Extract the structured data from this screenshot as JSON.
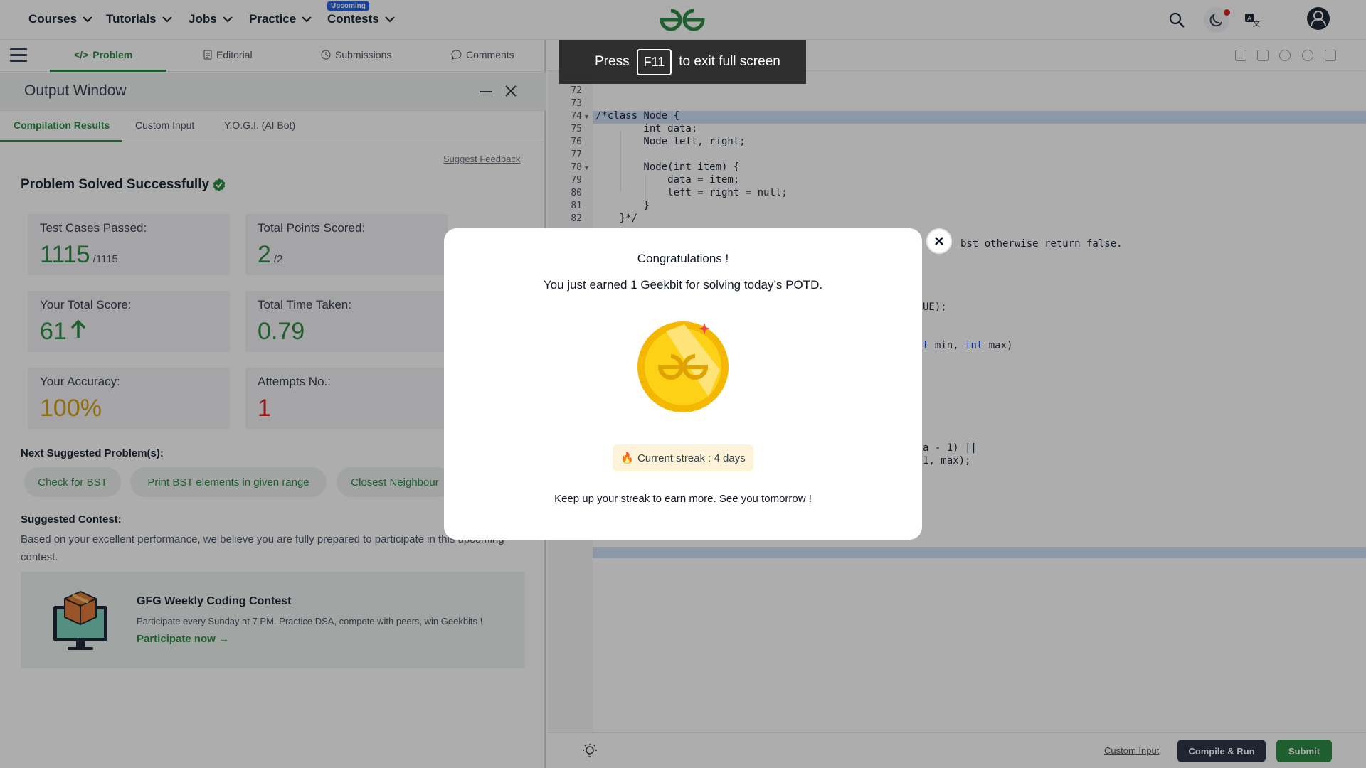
{
  "nav": {
    "items": [
      {
        "label": "Courses"
      },
      {
        "label": "Tutorials"
      },
      {
        "label": "Jobs"
      },
      {
        "label": "Practice"
      },
      {
        "label": "Contests"
      }
    ],
    "badge": "Upcoming",
    "icons": [
      "search-icon",
      "dark-mode-icon",
      "translate-icon",
      "profile-icon"
    ],
    "brand_color": "#2f8d46"
  },
  "problem_tabs": [
    {
      "label": "Problem",
      "icon": "code-icon"
    },
    {
      "label": "Editorial",
      "icon": "document-icon"
    },
    {
      "label": "Submissions",
      "icon": "clock-icon"
    },
    {
      "label": "Comments",
      "icon": "chat-icon"
    }
  ],
  "output_window": {
    "title": "Output Window",
    "tabs": [
      "Compilation Results",
      "Custom Input",
      "Y.O.G.I. (AI Bot)"
    ],
    "feedback": "Suggest Feedback",
    "status": "Problem Solved Successfully",
    "stats": {
      "tests_label": "Test Cases Passed:",
      "tests_value": "1115",
      "tests_total": "/1115",
      "points_label": "Total Points Scored:",
      "points_value": "2",
      "points_total": "/2",
      "score_label": "Your Total Score:",
      "score_value": "61",
      "time_label": "Total Time Taken:",
      "time_value": "0.79",
      "accuracy_label": "Your Accuracy:",
      "accuracy_value": "100%",
      "attempts_label": "Attempts No.:",
      "attempts_value": "1"
    },
    "next_label": "Next Suggested Problem(s):",
    "next_problems": [
      "Check for BST",
      "Print BST elements in given range",
      "Closest Neighbour"
    ],
    "contest_label": "Suggested Contest:",
    "contest_desc": "Based on your excellent performance, we believe you are fully prepared to participate in this upcoming contest.",
    "contest": {
      "title": "GFG Weekly Coding Contest",
      "text": "Participate every Sunday at 7 PM. Practice DSA, compete with peers, win Geekbits !",
      "link": "Participate now"
    }
  },
  "editor": {
    "lines": [
      {
        "n": "72",
        "code": ""
      },
      {
        "n": "73",
        "code": ""
      },
      {
        "n": "74",
        "code": "/*class Node {"
      },
      {
        "n": "75",
        "code": "        int data;"
      },
      {
        "n": "76",
        "code": "        Node left, right;"
      },
      {
        "n": "77",
        "code": ""
      },
      {
        "n": "78",
        "code": "        Node(int item) {"
      },
      {
        "n": "79",
        "code": "            data = item;"
      },
      {
        "n": "80",
        "code": "            left = right = null;"
      },
      {
        "n": "81",
        "code": "        }"
      },
      {
        "n": "82",
        "code": "    }*/"
      }
    ],
    "frag1": "bst otherwise return false.",
    "frag2": "UE);",
    "frag3_kw1": "t",
    "frag3_mid": " min, ",
    "frag3_kw2": "int",
    "frag3_end": " max)",
    "frag4": "a - 1) ||",
    "frag5": "1, max);",
    "bottom": {
      "custom_input": "Custom Input",
      "compile": "Compile & Run",
      "submit": "Submit"
    }
  },
  "fullscreen": {
    "prefix": "Press",
    "key": "F11",
    "suffix": "to exit full screen"
  },
  "modal": {
    "title": "Congratulations !",
    "subtitle": "You just earned 1 Geekbit for solving today’s POTD.",
    "streak": "Current streak : 4 days",
    "footer": "Keep up your streak to earn more. See you tomorrow !"
  }
}
